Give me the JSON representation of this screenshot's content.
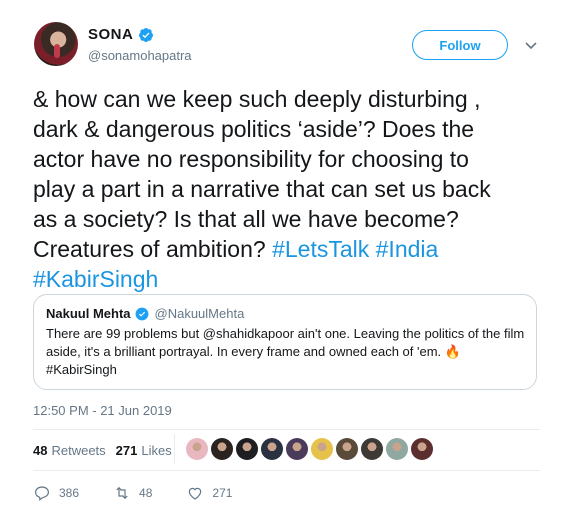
{
  "author": {
    "display_name": "SONA",
    "handle": "@sonamohapatra",
    "follow_label": "Follow"
  },
  "tweet": {
    "text_plain": "& how can we keep such deeply disturbing ,\ndark & dangerous politics ‘aside’? Does the\nactor have no responsibility for choosing to\nplay a part in a narrative that can set us back\nas a society? Is that all we have become?\nCreatures of ambition? ",
    "hashtag_1": "#LetsTalk",
    "hashtag_2": "#India",
    "hashtag_3": "#KabirSingh"
  },
  "quoted": {
    "name": "Nakuul Mehta",
    "handle": "@NakuulMehta",
    "text": "There are 99 problems but @shahidkapoor ain't one. Leaving the politics of the film aside, it's a brilliant portrayal. In every frame and owned each of 'em.",
    "flame": "🔥",
    "hashtag": "#KabirSingh"
  },
  "timestamp": "12:50 PM - 21 Jun 2019",
  "stats": {
    "retweets_count": "48",
    "retweets_label": "Retweets",
    "likes_count": "271",
    "likes_label": "Likes"
  },
  "likers_colors": [
    "#e8b7c0",
    "#2b2320",
    "#1d1d22",
    "#2a3140",
    "#4b3b5a",
    "#e6c24a",
    "#5a4a3a",
    "#3d3a35",
    "#8fa8a0",
    "#5c2f2f"
  ],
  "actions": {
    "replies": "386",
    "retweets": "48",
    "likes": "271"
  },
  "colors": {
    "accent": "#1da1f2",
    "hashtag": "#1b95e0",
    "muted": "#657786"
  }
}
